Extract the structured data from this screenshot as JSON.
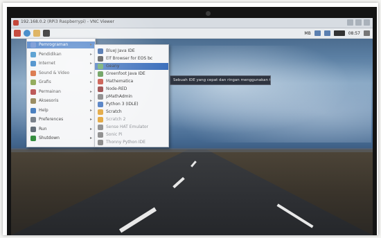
{
  "window": {
    "title": "192.168.0.2 (RPi3 Raspberrypi) - VNC Viewer"
  },
  "panel": {
    "tray_clock": "08:57",
    "tray_extra": "MB"
  },
  "menu": {
    "items": [
      {
        "label": "Pemrograman",
        "icon": "code-icon",
        "color": "#6b8fd1",
        "selected": true
      },
      {
        "label": "Pendidikan",
        "icon": "education-icon",
        "color": "#3a8ec9",
        "selected": false
      },
      {
        "label": "Internet",
        "icon": "globe-icon",
        "color": "#2f7fc4",
        "selected": false
      },
      {
        "label": "Sound & Video",
        "icon": "music-icon",
        "color": "#d35f2b",
        "selected": false
      },
      {
        "label": "Grafis",
        "icon": "graphics-icon",
        "color": "#7c9a3a",
        "selected": false
      },
      {
        "label": "Permainan",
        "icon": "game-icon",
        "color": "#b03a3a",
        "selected": false
      },
      {
        "label": "Aksesoris",
        "icon": "accessories-icon",
        "color": "#8a7a4a",
        "selected": false
      },
      {
        "label": "Help",
        "icon": "help-icon",
        "color": "#3470b8",
        "selected": false
      },
      {
        "label": "Preferences",
        "icon": "preferences-icon",
        "color": "#6e7680",
        "selected": false
      },
      {
        "label": "Run",
        "icon": "run-icon",
        "color": "#5a6570",
        "selected": false
      },
      {
        "label": "Shutdown",
        "icon": "shutdown-icon",
        "color": "#2f8a3a",
        "selected": false
      }
    ]
  },
  "submenu": {
    "items": [
      {
        "label": "BlueJ Java IDE",
        "icon": "bluej-icon",
        "color": "#2c5aa0",
        "selected": false,
        "faded": false
      },
      {
        "label": "Elf Browser for EOS bc",
        "icon": "browser-icon",
        "color": "#444",
        "selected": false,
        "faded": false
      },
      {
        "label": "Geany",
        "icon": "geany-icon",
        "color": "#5da35d",
        "selected": true,
        "faded": false
      },
      {
        "label": "Greenfoot Java IDE",
        "icon": "greenfoot-icon",
        "color": "#4a8a3a",
        "selected": false,
        "faded": false
      },
      {
        "label": "Mathematica",
        "icon": "mathematica-icon",
        "color": "#c0392b",
        "selected": false,
        "faded": false
      },
      {
        "label": "Node-RED",
        "icon": "nodered-icon",
        "color": "#8a2c2c",
        "selected": false,
        "faded": false
      },
      {
        "label": "pMathAdmin",
        "icon": "pmath-icon",
        "color": "#7a7a7a",
        "selected": false,
        "faded": false
      },
      {
        "label": "Python 3 (IDLE)",
        "icon": "python-icon",
        "color": "#3c6fbc",
        "selected": false,
        "faded": false
      },
      {
        "label": "Scratch",
        "icon": "scratch-icon",
        "color": "#e0a030",
        "selected": false,
        "faded": false
      },
      {
        "label": "Scratch 2",
        "icon": "scratch2-icon",
        "color": "#e0a030",
        "selected": false,
        "faded": true
      },
      {
        "label": "Sense HAT Emulator",
        "icon": "sensehat-icon",
        "color": "#8a8a8a",
        "selected": false,
        "faded": true
      },
      {
        "label": "Sonic Pi",
        "icon": "sonicpi-icon",
        "color": "#8a8a8a",
        "selected": false,
        "faded": true
      },
      {
        "label": "Thonny Python IDE",
        "icon": "thonny-icon",
        "color": "#8a8a8a",
        "selected": false,
        "faded": true
      }
    ]
  },
  "tooltip": {
    "text": "Sebuah IDE yang cepat dan ringan menggunakan GTK2"
  }
}
